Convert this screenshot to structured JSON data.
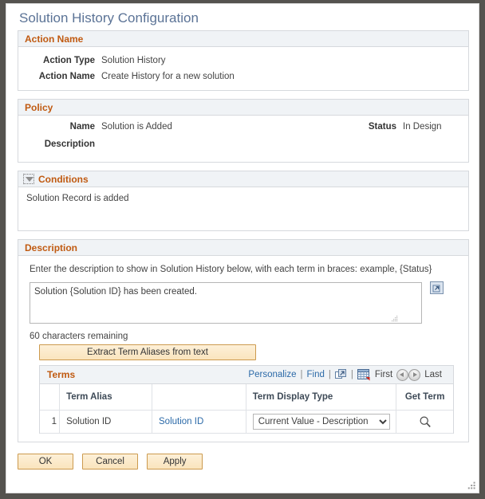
{
  "page": {
    "title": "Solution History Configuration"
  },
  "action_name_section": {
    "header": "Action Name",
    "fields": [
      {
        "label": "Action Type",
        "value": "Solution History"
      },
      {
        "label": "Action Name",
        "value": "Create History for a new solution"
      }
    ]
  },
  "policy_section": {
    "header": "Policy",
    "name_label": "Name",
    "name_value": "Solution is Added",
    "status_label": "Status",
    "status_value": "In Design",
    "description_label": "Description",
    "description_value": ""
  },
  "conditions_section": {
    "header": "Conditions",
    "collapse_icon": "triangle-down-icon",
    "text": "Solution Record is added"
  },
  "description_section": {
    "header": "Description",
    "instruction": "Enter the description to show in Solution History below, with each term in braces: example, {Status}",
    "textarea_value": "Solution {Solution ID} has been created.",
    "textarea_placeholder": "",
    "expand_icon": "expand-to-new-window-icon",
    "chars_remaining": "60 characters remaining",
    "extract_button": "Extract Term Aliases from text"
  },
  "terms_grid": {
    "title": "Terms",
    "personalize_link": "Personalize",
    "find_link": "Find",
    "separator": "|",
    "view_all_icon": "open-in-new-window-icon",
    "download_icon": "download-to-excel-icon",
    "first_label": "First",
    "prev_icon": "arrow-left-icon",
    "next_icon": "arrow-right-icon",
    "last_label": "Last",
    "columns": [
      "",
      "Term Alias",
      "",
      "Term Display Type",
      "Get Term"
    ],
    "rows": [
      {
        "num": "1",
        "term_alias": "Solution ID",
        "term_link": "Solution ID",
        "display_type": "Current Value - Description",
        "display_type_options": [
          "Current Value - Description"
        ],
        "get_term_icon": "magnifier-icon"
      }
    ]
  },
  "footer": {
    "ok_label": "OK",
    "cancel_label": "Cancel",
    "apply_label": "Apply"
  },
  "colors": {
    "section_header_text": "#c05a11",
    "section_header_bg": "#f0f3f6",
    "page_title": "#5b7396",
    "link": "#2c6aa8",
    "button_border": "#cc9a4e",
    "button_bg": "#fae4bd",
    "frame": "#55534f"
  }
}
